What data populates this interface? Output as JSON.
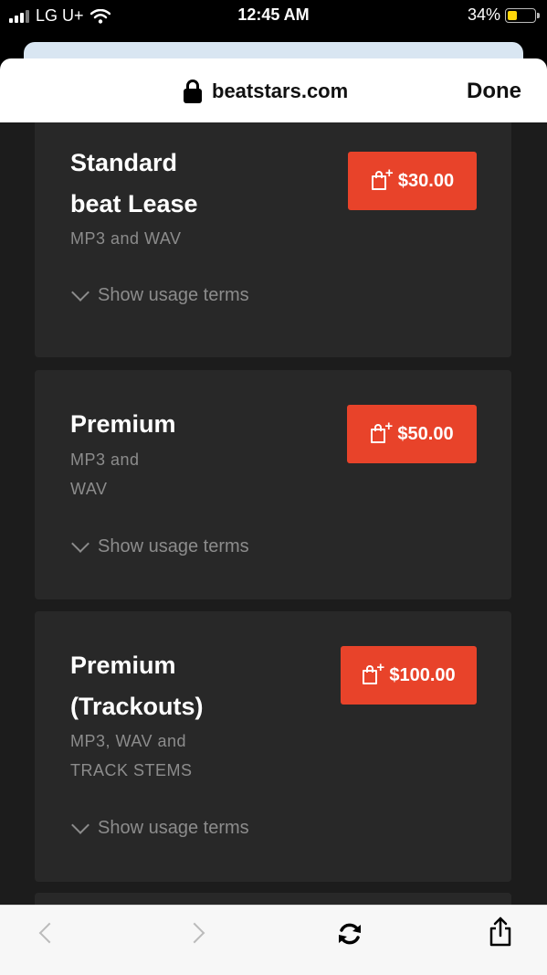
{
  "status_bar": {
    "carrier": "LG U+",
    "time": "12:45 AM",
    "battery_percent": "34%",
    "battery_level": 0.34
  },
  "url_bar": {
    "url": "beatstars.com",
    "done_label": "Done"
  },
  "licenses": [
    {
      "title_lines": [
        "Standard",
        "beat Lease"
      ],
      "description_lines": [
        "MP3 and WAV"
      ],
      "price": "$30.00",
      "terms_label": "Show usage terms"
    },
    {
      "title_lines": [
        "Premium"
      ],
      "description_lines": [
        "MP3 and",
        "WAV"
      ],
      "price": "$50.00",
      "terms_label": "Show usage terms"
    },
    {
      "title_lines": [
        "Premium",
        "(Trackouts)"
      ],
      "description_lines": [
        "MP3, WAV and",
        "TRACK STEMS"
      ],
      "price": "$100.00",
      "terms_label": "Show usage terms"
    }
  ],
  "colors": {
    "accent": "#e8432a",
    "card_bg": "#282828",
    "page_bg": "#1c1c1c",
    "muted_text": "#8c8c8c"
  },
  "icons": [
    "signal-bars-icon",
    "wifi-icon",
    "battery-icon",
    "lock-icon",
    "shopping-bag-plus-icon",
    "chevron-down-icon",
    "back-arrow-icon",
    "forward-arrow-icon",
    "reload-icon",
    "share-icon"
  ]
}
